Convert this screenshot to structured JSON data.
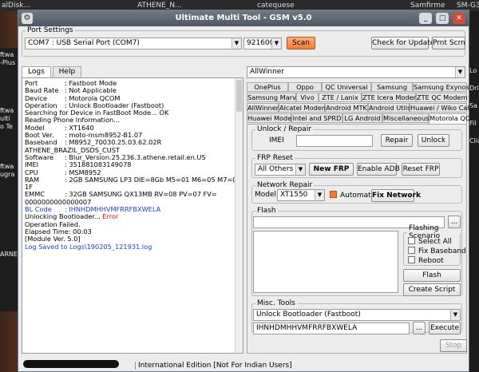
{
  "desktop": {
    "top_items": [
      "alDisk...",
      "ATHENE_N...",
      "catequese",
      "Samfirme",
      "SM-G3"
    ],
    "left_labels": [
      "ftwa",
      "-Plus",
      "ftwa",
      "ulti",
      "o Te",
      "ftwa",
      "ugra",
      "ARNE"
    ],
    "right_labels": [
      "Lo",
      "Dri",
      "Sa",
      "Fil",
      "Clic"
    ]
  },
  "window": {
    "title": "Ultimate Multi Tool - GSM v5.0",
    "minimize": "_",
    "maximize": "□",
    "close": "✕"
  },
  "port": {
    "legend": "Port Settings",
    "port_value": "COM7 : USB Serial Port (COM7)",
    "baud_value": "921600",
    "scan_label": "Scan",
    "check_update_label": "Check for Update",
    "prnt_scrn_label": "Prnt Scrn"
  },
  "log_tabs": [
    "Logs",
    "Help"
  ],
  "log": [
    {
      "k": "Port",
      "v": ": Fastboot Mode"
    },
    {
      "k": "Baud Rate",
      "v": ": Not Applicable"
    },
    {
      "k": "Device",
      "v": ": Motorola QCOM"
    },
    {
      "k": "Operation",
      "v": ": Unlock Bootloader (Fastboot)"
    },
    {
      "k": "",
      "v": "Searching for Device in FastBoot Mode... OK"
    },
    {
      "k": "",
      "v": "Reading Phone Information..."
    },
    {
      "k": "Model",
      "v": ": XT1640"
    },
    {
      "k": "Boot Ver.",
      "v": ": moto-msm8952-B1.07"
    },
    {
      "k": "Baseband",
      "v": ": M8952_70030.25.03.62.02R"
    },
    {
      "k": "",
      "v": "ATHENE_BRAZIL_DSDS_CUST"
    },
    {
      "k": "Software",
      "v": ": Blur_Version.25.236.3.athene.retail.en.US"
    },
    {
      "k": "IMEI",
      "v": ": 351881083149078"
    },
    {
      "k": "CPU",
      "v": ": MSM8952"
    },
    {
      "k": "RAM",
      "v": ": 2GB SAMSUNG LP3 DIE=8Gb M5=01 M6=05 M7=00 M8="
    },
    {
      "k": "",
      "v": "1F"
    },
    {
      "k": "EMMC",
      "v": ": 32GB SAMSUNG QX13MB RV=08 PV=07 FV="
    },
    {
      "k": "",
      "v": "0000000000000007"
    },
    {
      "k": "BL Code",
      "v": ": IHNHDMHHVMFRRFBXWELA",
      "color": "#1a3fd0"
    },
    {
      "k": "",
      "v": "Unlocking Bootloader... ",
      "extra": "Error",
      "extra_color": "#d01010"
    },
    {
      "k": "",
      "v": "Operation Failed."
    },
    {
      "k": "",
      "v": "Elapsed Time: 00:03"
    },
    {
      "k": "",
      "v": "[Module Ver. 5.0]"
    },
    {
      "k": "",
      "v": "Log Saved to Logs\\190205_121931.log",
      "color": "#1a3fd0"
    }
  ],
  "platform": {
    "value": "AllWinner"
  },
  "tabs": {
    "row1": [
      "OnePlus",
      "Oppo",
      "QC Universal",
      "Samsung",
      "Samsung Exynos"
    ],
    "row2": [
      "Samsung Marvel",
      "Vivo",
      "ZTE / Lanix",
      "ZTE Icera Modem",
      "ZTE QC Modem"
    ],
    "row3": [
      "AllWinner",
      "Alcatel Modem",
      "Android MTK",
      "Android Utils",
      "Huawei / Wiko Calc"
    ],
    "row4": [
      "Intel and SPRD",
      "LG Android",
      "Miscellaneous"
    ],
    "row5": [
      "Huawei Modem",
      "Motorola QC"
    ]
  },
  "unlock": {
    "legend": "Unlock / Repair",
    "imei_label": "IMEI",
    "imei_value": "",
    "repair_label": "Repair",
    "unlock_label": "Unlock"
  },
  "frp": {
    "legend": "FRP Reset",
    "select_value": "All Others",
    "new_frp_label": "New FRP",
    "enable_adb_label": "Enable ADB",
    "reset_frp_label": "Reset FRP"
  },
  "network": {
    "legend": "Network Repair",
    "model_label": "Model",
    "model_value": "XT1550",
    "automatic_label": "Automatic",
    "automatic_checked": true,
    "fix_label": "Fix Network"
  },
  "flash": {
    "legend": "Flash",
    "file_value": "",
    "browse_label": "...",
    "scenario_legend": "Flashing Scenario",
    "options": [
      "Select All",
      "Fix Baseband",
      "Reboot"
    ],
    "flash_label": "Flash",
    "create_script_label": "Create Script"
  },
  "misc": {
    "legend": "Misc. Tools",
    "select_value": "Unlock Bootloader (Fastboot)",
    "input_value": "IHNHDMHHVMFRRFBXWELA",
    "browse_label": "...",
    "execute_label": "Execute"
  },
  "stop_label": "Stop",
  "status": {
    "text": "International Edition [Not For Indian Users]"
  }
}
